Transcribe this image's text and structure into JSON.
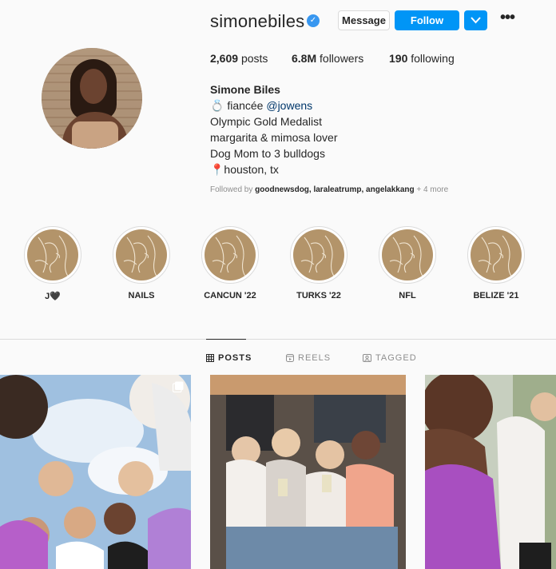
{
  "profile": {
    "username": "simonebiles",
    "verified_mark": "✓",
    "message_label": "Message",
    "follow_label": "Follow",
    "more_label": "•••",
    "stats": {
      "posts_count": "2,609",
      "posts_label": "posts",
      "followers_count": "6.8M",
      "followers_label": "followers",
      "following_count": "190",
      "following_label": "following"
    },
    "bio": {
      "name": "Simone Biles",
      "line1_prefix": "💍 fiancée ",
      "line1_mention": "@jowens",
      "line2": "Olympic Gold Medalist",
      "line3": "margarita & mimosa lover",
      "line4": "Dog Mom to 3 bulldogs",
      "line5": "📍houston, tx"
    },
    "followed_by": {
      "prefix": "Followed by ",
      "users": "goodnewsdog, laraleatrump, angelakkang",
      "suffix": " + 4 more"
    }
  },
  "highlights": [
    {
      "label": "J🖤"
    },
    {
      "label": "NAILS"
    },
    {
      "label": "CANCUN '22"
    },
    {
      "label": "TURKS '22"
    },
    {
      "label": "NFL"
    },
    {
      "label": "BELIZE '21"
    }
  ],
  "tabs": [
    {
      "label": "POSTS",
      "icon": "grid-icon",
      "active": true
    },
    {
      "label": "REELS",
      "icon": "reels-icon",
      "active": false
    },
    {
      "label": "TAGGED",
      "icon": "tagged-icon",
      "active": false
    }
  ],
  "posts": [
    {
      "kind": "carousel",
      "alt_icon": "multiple-icon"
    },
    {
      "kind": "photo"
    },
    {
      "kind": "photo"
    }
  ],
  "colors": {
    "accent": "#0095f6",
    "verified": "#3897f0",
    "highlight_bg": "#b3946a"
  }
}
